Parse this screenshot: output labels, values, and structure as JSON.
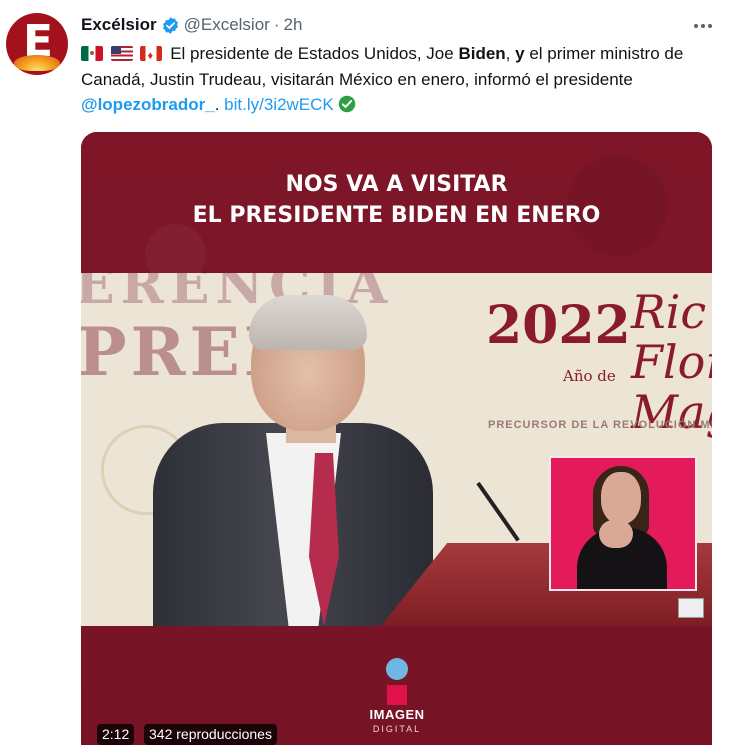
{
  "author": {
    "display_name": "Excélsior",
    "handle": "@Excelsior",
    "separator": "·",
    "time": "2h",
    "avatar_letter": "E"
  },
  "tweet": {
    "part1": "El presidente de Estados Unidos, Joe ",
    "bold1": "Biden",
    "part2": ", ",
    "bold2": "y",
    "part3": " el primer ministro de Canadá, Justin Trudeau, visitarán México en enero, informó el presidente ",
    "mention": "@lopezobrador_",
    "part4": ". ",
    "link": "bit.ly/3i2wECK",
    "flags": [
      "mexico-flag",
      "us-flag",
      "canada-flag"
    ]
  },
  "media": {
    "headline_line1": "NOS VA A VISITAR",
    "headline_line2": "EL PRESIDENTE BIDEN EN ENERO",
    "backdrop_text1": "ERENCIA",
    "backdrop_text2": "PREN",
    "backdrop_year": "2022",
    "backdrop_anio": "Año de",
    "backdrop_flores": "Ric\nFlor\nMag",
    "backdrop_precursor": "PRECURSOR DE LA REVOLUCIÓN ME",
    "logo_line1": "IMAGEN",
    "logo_line2": "DIGITAL",
    "duration": "2:12",
    "views": "342 reproducciones"
  },
  "colors": {
    "link": "#1d9bf0",
    "secondary_text": "#536471",
    "media_bg": "#7a1527",
    "brand_red": "#a3111d"
  }
}
